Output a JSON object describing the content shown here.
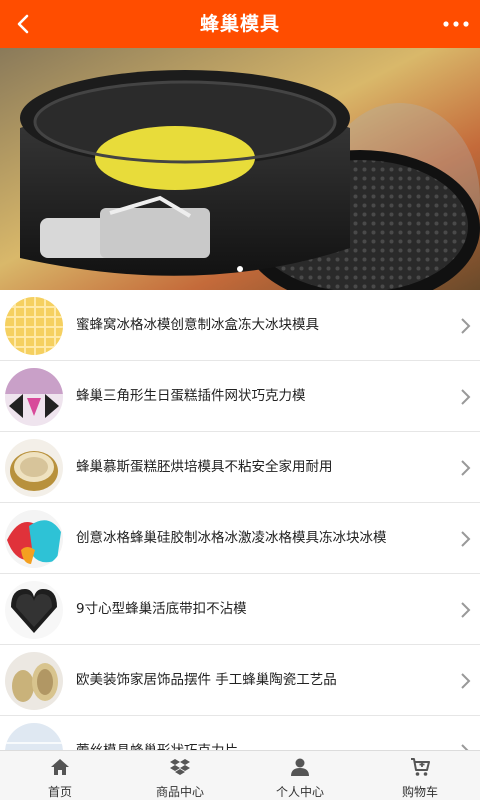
{
  "header": {
    "title": "蜂巢模具",
    "back_icon": "chevron-left-icon",
    "more_icon": "more-dots-icon",
    "color": "#ff4d00"
  },
  "banner": {
    "image": "springform-cake-pan-photo",
    "slide_count": 1,
    "active_slide": 1
  },
  "products": [
    {
      "label": "蜜蜂窝冰格冰模创意制冰盒冻大冰块模具",
      "thumb": "yellow-ice-tray"
    },
    {
      "label": "蜂巢三角形生日蛋糕插件网状巧克力模",
      "thumb": "pink-triangle-mold"
    },
    {
      "label": "蜂巢慕斯蛋糕胚烘培模具不粘安全家用耐用",
      "thumb": "gold-round-cake-pan"
    },
    {
      "label": "创意冰格蜂巢硅胶制冰格冰激凌冰格模具冻冰块冰模",
      "thumb": "colorful-silicone-ice-molds"
    },
    {
      "label": "9寸心型蜂巢活底带扣不沾模",
      "thumb": "black-heart-pan"
    },
    {
      "label": "欧美装饰家居饰品摆件 手工蜂巢陶瓷工艺品",
      "thumb": "ceramic-vases"
    },
    {
      "label": "蕾丝模具蜂巢形状巧克力片",
      "thumb": "lace-mat"
    }
  ],
  "tabbar": {
    "tabs": [
      {
        "label": "首页",
        "icon": "home-icon"
      },
      {
        "label": "商品中心",
        "icon": "dropbox-icon"
      },
      {
        "label": "个人中心",
        "icon": "user-icon"
      },
      {
        "label": "购物车",
        "icon": "cart-icon"
      }
    ]
  }
}
